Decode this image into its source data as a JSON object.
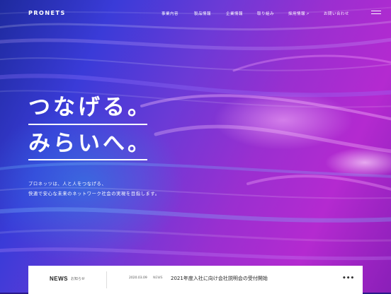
{
  "brand": {
    "logo": "PRONETS"
  },
  "nav": {
    "items": [
      {
        "label": "事業内容"
      },
      {
        "label": "製品情報"
      },
      {
        "label": "企業情報"
      },
      {
        "label": "取り組み"
      },
      {
        "label": "採用情報",
        "external_icon": "↗"
      },
      {
        "label": "お問い合わせ"
      }
    ],
    "menu_icon": "hamburger-icon"
  },
  "hero": {
    "headline": [
      "つなげる。",
      "みらいへ。"
    ],
    "description": [
      "プロネッツは、人と人をつなげる、",
      "快適で安心な未来のネットワーク社会の実現を目指します。"
    ],
    "colors": {
      "deep_blue": "#1e2a9e",
      "violet": "#6b3ad6",
      "magenta": "#b42ad0"
    }
  },
  "news": {
    "title": "NEWS",
    "subtitle": "お知らせ",
    "items": [
      {
        "date": "2020.03.09",
        "tag": "NEWS",
        "text": "2021年度入社に向け会社説明会の受付開始"
      }
    ],
    "more_icon": "more-dots-icon",
    "more_label": "•••"
  }
}
